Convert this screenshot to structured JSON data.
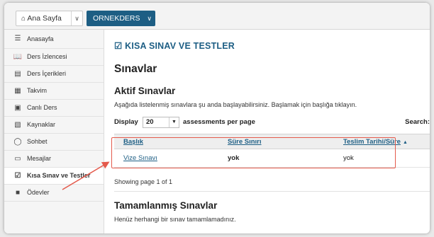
{
  "topbar": {
    "home_label": "Ana Sayfa",
    "course_label": "ORNEKDERS"
  },
  "sidebar": {
    "items": [
      {
        "label": "Anasayfa",
        "icon": "list-icon"
      },
      {
        "label": "Ders İzlencesi",
        "icon": "book-open-icon"
      },
      {
        "label": "Ders İçerikleri",
        "icon": "books-icon"
      },
      {
        "label": "Takvim",
        "icon": "calendar-icon"
      },
      {
        "label": "Canlı Ders",
        "icon": "video-camera-icon"
      },
      {
        "label": "Kaynaklar",
        "icon": "folder-icon"
      },
      {
        "label": "Sohbet",
        "icon": "chat-icon"
      },
      {
        "label": "Mesajlar",
        "icon": "inbox-icon"
      },
      {
        "label": "Kısa Sınav ve Testler",
        "icon": "checkbox-icon",
        "active": true
      },
      {
        "label": "Ödevler",
        "icon": "document-icon"
      }
    ]
  },
  "main": {
    "section_title": "KISA SINAV VE TESTLER",
    "heading": "Sınavlar",
    "active_heading": "Aktif Sınavlar",
    "intro": "Aşağıda listelenmiş sınavlara şu anda başlayabilirsiniz. Başlamak için başlığa tıklayın.",
    "display_label": "Display",
    "per_page_value": "20",
    "per_page_label": "assessments per page",
    "search_label": "Search:",
    "table": {
      "headers": [
        "Başlık",
        "Süre Sınırı",
        "Teslim Tarihi/Süre"
      ],
      "rows": [
        [
          "Vize Sınavı",
          "yok",
          "yok"
        ]
      ]
    },
    "showing": "Showing page 1 of 1",
    "completed_heading": "Tamamlanmış Sınavlar",
    "completed_text": "Henüz herhangi bir sınav tamamlamadınız."
  },
  "colors": {
    "brand": "#1d5e84",
    "annotation": "#e45a4c"
  }
}
